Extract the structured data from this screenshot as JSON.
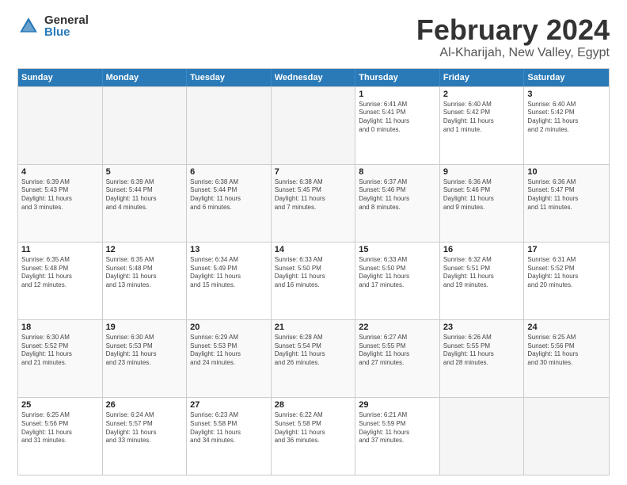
{
  "logo": {
    "general": "General",
    "blue": "Blue"
  },
  "header": {
    "title": "February 2024",
    "location": "Al-Kharijah, New Valley, Egypt"
  },
  "dayNames": [
    "Sunday",
    "Monday",
    "Tuesday",
    "Wednesday",
    "Thursday",
    "Friday",
    "Saturday"
  ],
  "rows": [
    [
      {
        "date": "",
        "info": ""
      },
      {
        "date": "",
        "info": ""
      },
      {
        "date": "",
        "info": ""
      },
      {
        "date": "",
        "info": ""
      },
      {
        "date": "1",
        "info": "Sunrise: 6:41 AM\nSunset: 5:41 PM\nDaylight: 11 hours\nand 0 minutes."
      },
      {
        "date": "2",
        "info": "Sunrise: 6:40 AM\nSunset: 5:42 PM\nDaylight: 11 hours\nand 1 minute."
      },
      {
        "date": "3",
        "info": "Sunrise: 6:40 AM\nSunset: 5:42 PM\nDaylight: 11 hours\nand 2 minutes."
      }
    ],
    [
      {
        "date": "4",
        "info": "Sunrise: 6:39 AM\nSunset: 5:43 PM\nDaylight: 11 hours\nand 3 minutes."
      },
      {
        "date": "5",
        "info": "Sunrise: 6:39 AM\nSunset: 5:44 PM\nDaylight: 11 hours\nand 4 minutes."
      },
      {
        "date": "6",
        "info": "Sunrise: 6:38 AM\nSunset: 5:44 PM\nDaylight: 11 hours\nand 6 minutes."
      },
      {
        "date": "7",
        "info": "Sunrise: 6:38 AM\nSunset: 5:45 PM\nDaylight: 11 hours\nand 7 minutes."
      },
      {
        "date": "8",
        "info": "Sunrise: 6:37 AM\nSunset: 5:46 PM\nDaylight: 11 hours\nand 8 minutes."
      },
      {
        "date": "9",
        "info": "Sunrise: 6:36 AM\nSunset: 5:46 PM\nDaylight: 11 hours\nand 9 minutes."
      },
      {
        "date": "10",
        "info": "Sunrise: 6:36 AM\nSunset: 5:47 PM\nDaylight: 11 hours\nand 11 minutes."
      }
    ],
    [
      {
        "date": "11",
        "info": "Sunrise: 6:35 AM\nSunset: 5:48 PM\nDaylight: 11 hours\nand 12 minutes."
      },
      {
        "date": "12",
        "info": "Sunrise: 6:35 AM\nSunset: 5:48 PM\nDaylight: 11 hours\nand 13 minutes."
      },
      {
        "date": "13",
        "info": "Sunrise: 6:34 AM\nSunset: 5:49 PM\nDaylight: 11 hours\nand 15 minutes."
      },
      {
        "date": "14",
        "info": "Sunrise: 6:33 AM\nSunset: 5:50 PM\nDaylight: 11 hours\nand 16 minutes."
      },
      {
        "date": "15",
        "info": "Sunrise: 6:33 AM\nSunset: 5:50 PM\nDaylight: 11 hours\nand 17 minutes."
      },
      {
        "date": "16",
        "info": "Sunrise: 6:32 AM\nSunset: 5:51 PM\nDaylight: 11 hours\nand 19 minutes."
      },
      {
        "date": "17",
        "info": "Sunrise: 6:31 AM\nSunset: 5:52 PM\nDaylight: 11 hours\nand 20 minutes."
      }
    ],
    [
      {
        "date": "18",
        "info": "Sunrise: 6:30 AM\nSunset: 5:52 PM\nDaylight: 11 hours\nand 21 minutes."
      },
      {
        "date": "19",
        "info": "Sunrise: 6:30 AM\nSunset: 5:53 PM\nDaylight: 11 hours\nand 23 minutes."
      },
      {
        "date": "20",
        "info": "Sunrise: 6:29 AM\nSunset: 5:53 PM\nDaylight: 11 hours\nand 24 minutes."
      },
      {
        "date": "21",
        "info": "Sunrise: 6:28 AM\nSunset: 5:54 PM\nDaylight: 11 hours\nand 26 minutes."
      },
      {
        "date": "22",
        "info": "Sunrise: 6:27 AM\nSunset: 5:55 PM\nDaylight: 11 hours\nand 27 minutes."
      },
      {
        "date": "23",
        "info": "Sunrise: 6:26 AM\nSunset: 5:55 PM\nDaylight: 11 hours\nand 28 minutes."
      },
      {
        "date": "24",
        "info": "Sunrise: 6:25 AM\nSunset: 5:56 PM\nDaylight: 11 hours\nand 30 minutes."
      }
    ],
    [
      {
        "date": "25",
        "info": "Sunrise: 6:25 AM\nSunset: 5:56 PM\nDaylight: 11 hours\nand 31 minutes."
      },
      {
        "date": "26",
        "info": "Sunrise: 6:24 AM\nSunset: 5:57 PM\nDaylight: 11 hours\nand 33 minutes."
      },
      {
        "date": "27",
        "info": "Sunrise: 6:23 AM\nSunset: 5:58 PM\nDaylight: 11 hours\nand 34 minutes."
      },
      {
        "date": "28",
        "info": "Sunrise: 6:22 AM\nSunset: 5:58 PM\nDaylight: 11 hours\nand 36 minutes."
      },
      {
        "date": "29",
        "info": "Sunrise: 6:21 AM\nSunset: 5:59 PM\nDaylight: 11 hours\nand 37 minutes."
      },
      {
        "date": "",
        "info": ""
      },
      {
        "date": "",
        "info": ""
      }
    ]
  ]
}
